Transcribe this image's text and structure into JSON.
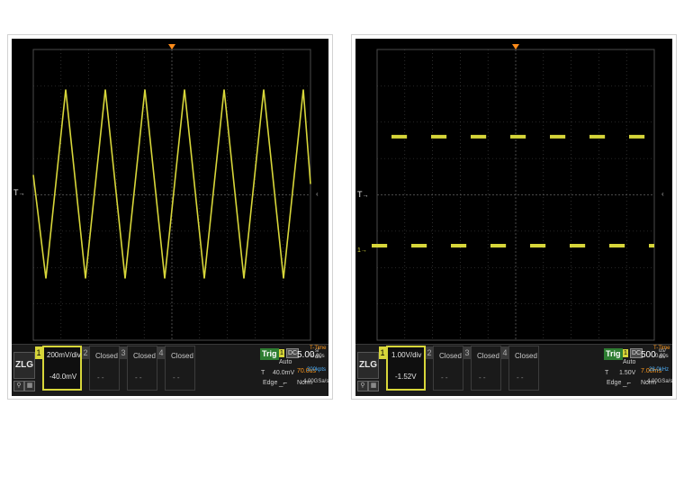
{
  "colors": {
    "trace": "#d7d63a",
    "grid": "#4a4a4a",
    "trigger_marker": "#ff8c1a",
    "delay_text": "#ff9a1f",
    "rate_text": "#4fb3ff"
  },
  "scopes": [
    {
      "brand": "ZLG",
      "ch1": {
        "number": "1",
        "scale": "200mV/div",
        "offset": "-40.0mV"
      },
      "channels": [
        {
          "number": "2",
          "state": "Closed",
          "dashes": "- -"
        },
        {
          "number": "3",
          "state": "Closed",
          "dashes": "- -"
        },
        {
          "number": "4",
          "state": "Closed",
          "dashes": "- -"
        }
      ],
      "trigger": {
        "label": "Trig",
        "source": "1",
        "coupling": "DC",
        "mode": "Auto",
        "level_prefix": "T",
        "level": "40.0mV",
        "type": "Edge"
      },
      "timebase": {
        "value": "5.00",
        "unit": "s/",
        "unit2": "div",
        "delay": "70.0us",
        "rate_prefix": "200kHz"
      },
      "ttime": {
        "label": "T-Time",
        "value": "0.00s",
        "rate": "200kpts",
        "norm": "Norm",
        "sample_rate": "4.00GSa/s"
      },
      "markers": {
        "trig": "T",
        "ch": "1"
      },
      "waveform": {
        "type": "triangle",
        "peaks": 7,
        "high_div": 6.9,
        "low_div": 1.7
      }
    },
    {
      "brand": "ZLG",
      "ch1": {
        "number": "1",
        "scale": "1.00V/div",
        "offset": "-1.52V"
      },
      "channels": [
        {
          "number": "2",
          "state": "Closed",
          "dashes": "- -"
        },
        {
          "number": "3",
          "state": "Closed",
          "dashes": "- -"
        },
        {
          "number": "4",
          "state": "Closed",
          "dashes": "- -"
        }
      ],
      "trigger": {
        "label": "Trig",
        "source": "1",
        "coupling": "DC",
        "mode": "Auto",
        "level_prefix": "T",
        "level": "1.50V",
        "type": "Edge"
      },
      "timebase": {
        "value": "500",
        "unit": "us/",
        "unit2": "div",
        "delay": "7.00ms",
        "rate_prefix": "28.0kHz"
      },
      "ttime": {
        "label": "T-Time",
        "value": "0.00s",
        "rate": "",
        "norm": "Norm",
        "sample_rate": "4.00GSa/s"
      },
      "markers": {
        "trig": "T",
        "ch": "1"
      },
      "waveform": {
        "type": "square",
        "high_div": 5.6,
        "low_div": 2.6
      }
    }
  ]
}
